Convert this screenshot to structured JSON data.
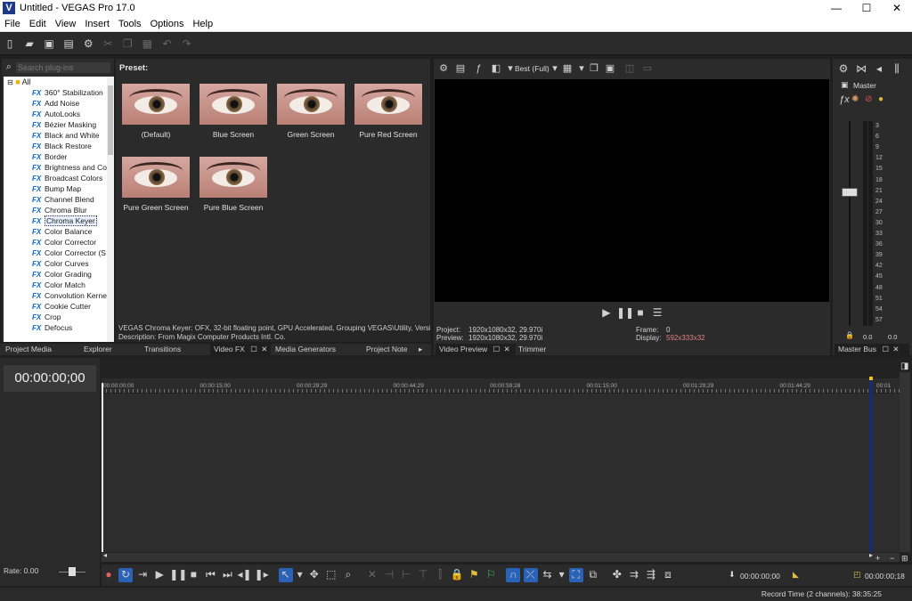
{
  "window": {
    "title": "Untitled - VEGAS Pro 17.0",
    "logo_letter": "V",
    "min": "—",
    "max": "☐",
    "close": "✕"
  },
  "menu": [
    "File",
    "Edit",
    "View",
    "Insert",
    "Tools",
    "Options",
    "Help"
  ],
  "plugins": {
    "search_placeholder": "Search plug-ins",
    "root": "All",
    "fx_badge": "FX",
    "items": [
      "360° Stabilization",
      "Add Noise",
      "AutoLooks",
      "Bézier Masking",
      "Black and White",
      "Black Restore",
      "Border",
      "Brightness and Co",
      "Broadcast Colors",
      "Bump Map",
      "Channel Blend",
      "Chroma Blur",
      "Chroma Keyer",
      "Color Balance",
      "Color Corrector",
      "Color Corrector (S",
      "Color Curves",
      "Color Grading",
      "Color Match",
      "Convolution Kerne",
      "Cookie Cutter",
      "Crop",
      "Defocus"
    ],
    "selected": "Chroma Keyer"
  },
  "preset": {
    "label": "Preset:",
    "items": [
      "(Default)",
      "Blue Screen",
      "Green Screen",
      "Pure Red Screen",
      "Pure Green Screen",
      "Pure Blue Screen"
    ],
    "description_line1": "VEGAS Chroma Keyer: OFX, 32-bit floating point, GPU Accelerated, Grouping VEGAS\\Utility, Versi",
    "description_line2": "Description: From Magix Computer Products Intl. Co."
  },
  "left_tabs": [
    "Project Media",
    "Explorer",
    "Transitions",
    "Video FX",
    "Media Generators",
    "Project Note"
  ],
  "preview": {
    "quality": "Best (Full)",
    "project_label": "Project:",
    "project_value": "1920x1080x32, 29.970i",
    "preview_label": "Preview:",
    "preview_value": "1920x1080x32, 29.970i",
    "frame_label": "Frame:",
    "frame_value": "0",
    "display_label": "Display:",
    "display_value": "592x333x32",
    "tabs": [
      "Video Preview",
      "Trimmer"
    ]
  },
  "master": {
    "label": "Master",
    "ticks": [
      "3",
      "6",
      "9",
      "12",
      "15",
      "18",
      "21",
      "24",
      "27",
      "30",
      "33",
      "36",
      "39",
      "42",
      "45",
      "48",
      "51",
      "54",
      "57"
    ],
    "level_left": "0.0",
    "level_right": "0.0",
    "tab": "Master Bus"
  },
  "timeline": {
    "time": "00:00:00;00",
    "ruler": [
      "00:00:00;00",
      "00:00:15;00",
      "00:00:29;29",
      "00:00:44;29",
      "00:00:59;28",
      "00:01:15;00",
      "00:01:29;29",
      "00:01:44;29",
      "00:01"
    ],
    "rate": "Rate: 0.00",
    "cursor_time": "00:00:00;00",
    "end_time": "00:00:00;18"
  },
  "status": {
    "record_time": "Record Time (2 channels): 38:35:25"
  },
  "colors": {
    "accent_blue": "#2a62b8",
    "display_value": "#e08080"
  }
}
